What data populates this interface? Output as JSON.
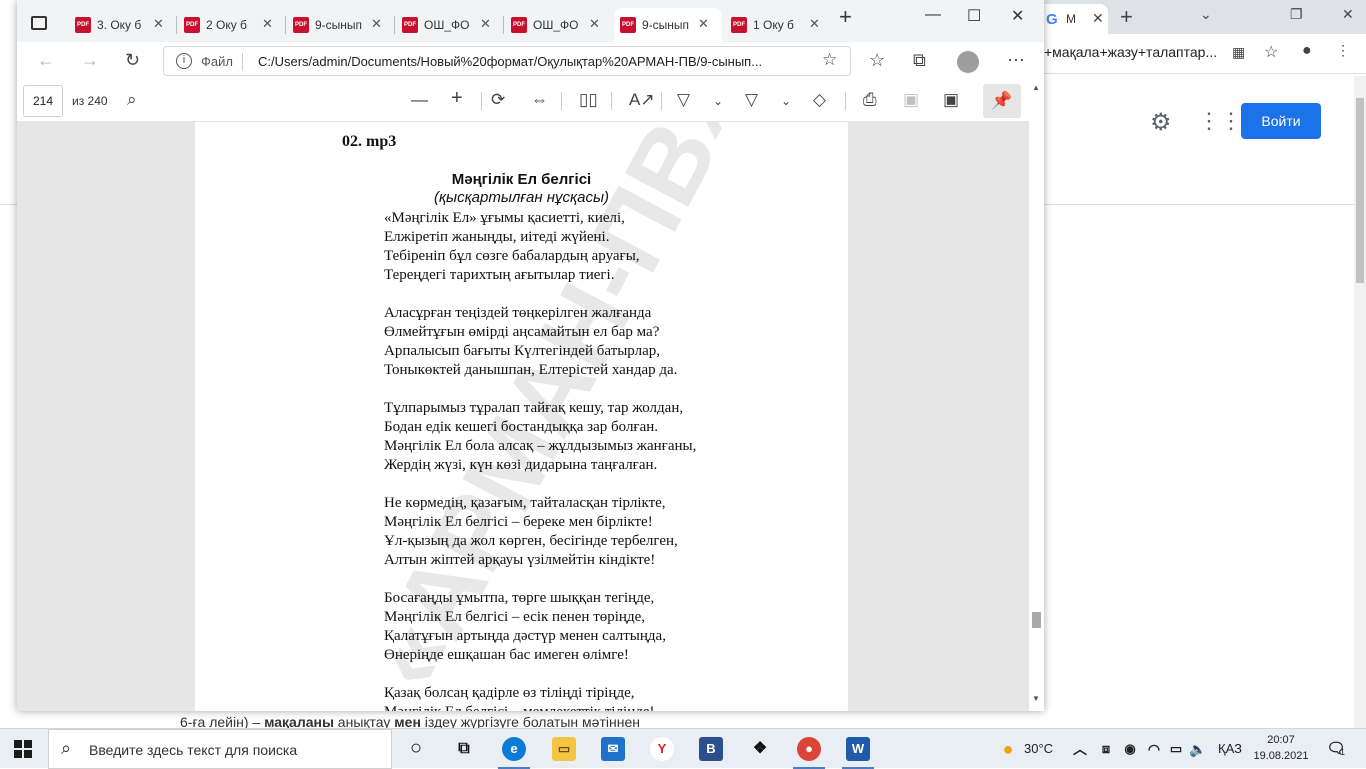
{
  "background_window": {
    "tab_label": "М",
    "address_fragment": "+мақала+жазу+талаптар...",
    "signin_label": "Войти",
    "bottom_text_parts": [
      "6-ға лейін) – ",
      "мақаланы",
      " анықтау ",
      "мен",
      " іздеу жүргізуге болатын мәтіннен"
    ]
  },
  "browser": {
    "tabs": [
      {
        "label": "3. Оку б",
        "active": false
      },
      {
        "label": "2 Оку б",
        "active": false
      },
      {
        "label": "9-сынып",
        "active": false
      },
      {
        "label": "ОШ_ФО",
        "active": false
      },
      {
        "label": "ОШ_ФО",
        "active": false
      },
      {
        "label": "9-сынып",
        "active": true
      },
      {
        "label": "1 Оку б",
        "active": false
      }
    ],
    "address": {
      "scheme": "Файл",
      "url": "C:/Users/admin/Documents/Новый%20формат/Оқулықтар%20АРМАН-ПВ/9-сынып..."
    }
  },
  "pdf_toolbar": {
    "page_current": "214",
    "page_total": "из 240"
  },
  "document": {
    "audio_label": "02. mp3",
    "title": "Мәңгілік Ел белгісі",
    "subtitle": "(қысқартылған нұсқасы)",
    "watermark": "«АРМАН-ПВ» баспасы",
    "stanzas": [
      [
        "«Мәңгілік Ел» ұғымы қасиетті, киелі,",
        "Елжіретіп жаныңды, иітеді жүйені.",
        "Тебіреніп бұл сөзге бабалардың аруағы,",
        "Тереңдегі тарихтың ағытылар тиегі."
      ],
      [
        "Аласұрған теңіздей төңкерілген жалғанда",
        "Өлмейтұғын өмірді аңсамайтын ел бар ма?",
        "Арпалысып бағыты Күлтегіндей батырлар,",
        "Тоныкөктей данышпан, Елтерістей хандар да."
      ],
      [
        "Тұлпарымыз тұралап тайғақ кешу, тар жолдан,",
        "Бодан едік кешегі бостандыққа зар болған.",
        "Мәңгілік Ел бола алсақ – жұлдызымыз жанғаны,",
        "Жердің жүзі, күн көзі дидарына таңғалған."
      ],
      [
        "Не көрмедің, қазағым, тайталасқан тірлікте,",
        "Мәңгілік Ел белгісі – береке мен бірлікте!",
        "Ұл-қызың да жол көрген, бесігінде тербелген,",
        "Алтын жіптей арқауы үзілмейтін кіндікте!"
      ],
      [
        "Босағаңды ұмытпа, төрге шыққан тегіңде,",
        "Мәңгілік Ел белгісі – есік пенен төріңде,",
        "Қалатұғын артыңда дәстүр менен салтыңда,",
        "Өнеріңде ешқашан бас имеген өлімге!"
      ],
      [
        "Қазақ болсаң қадірле өз тіліңді тіріңде,",
        "Мәңгілік Ел белгісі – мемлекеттік тілінде!"
      ]
    ]
  },
  "taskbar": {
    "search_placeholder": "Введите здесь текст для поиска",
    "weather": "30°C",
    "language": "ҚАЗ",
    "time": "20:07",
    "date": "19.08.2021",
    "notifications": "1"
  }
}
